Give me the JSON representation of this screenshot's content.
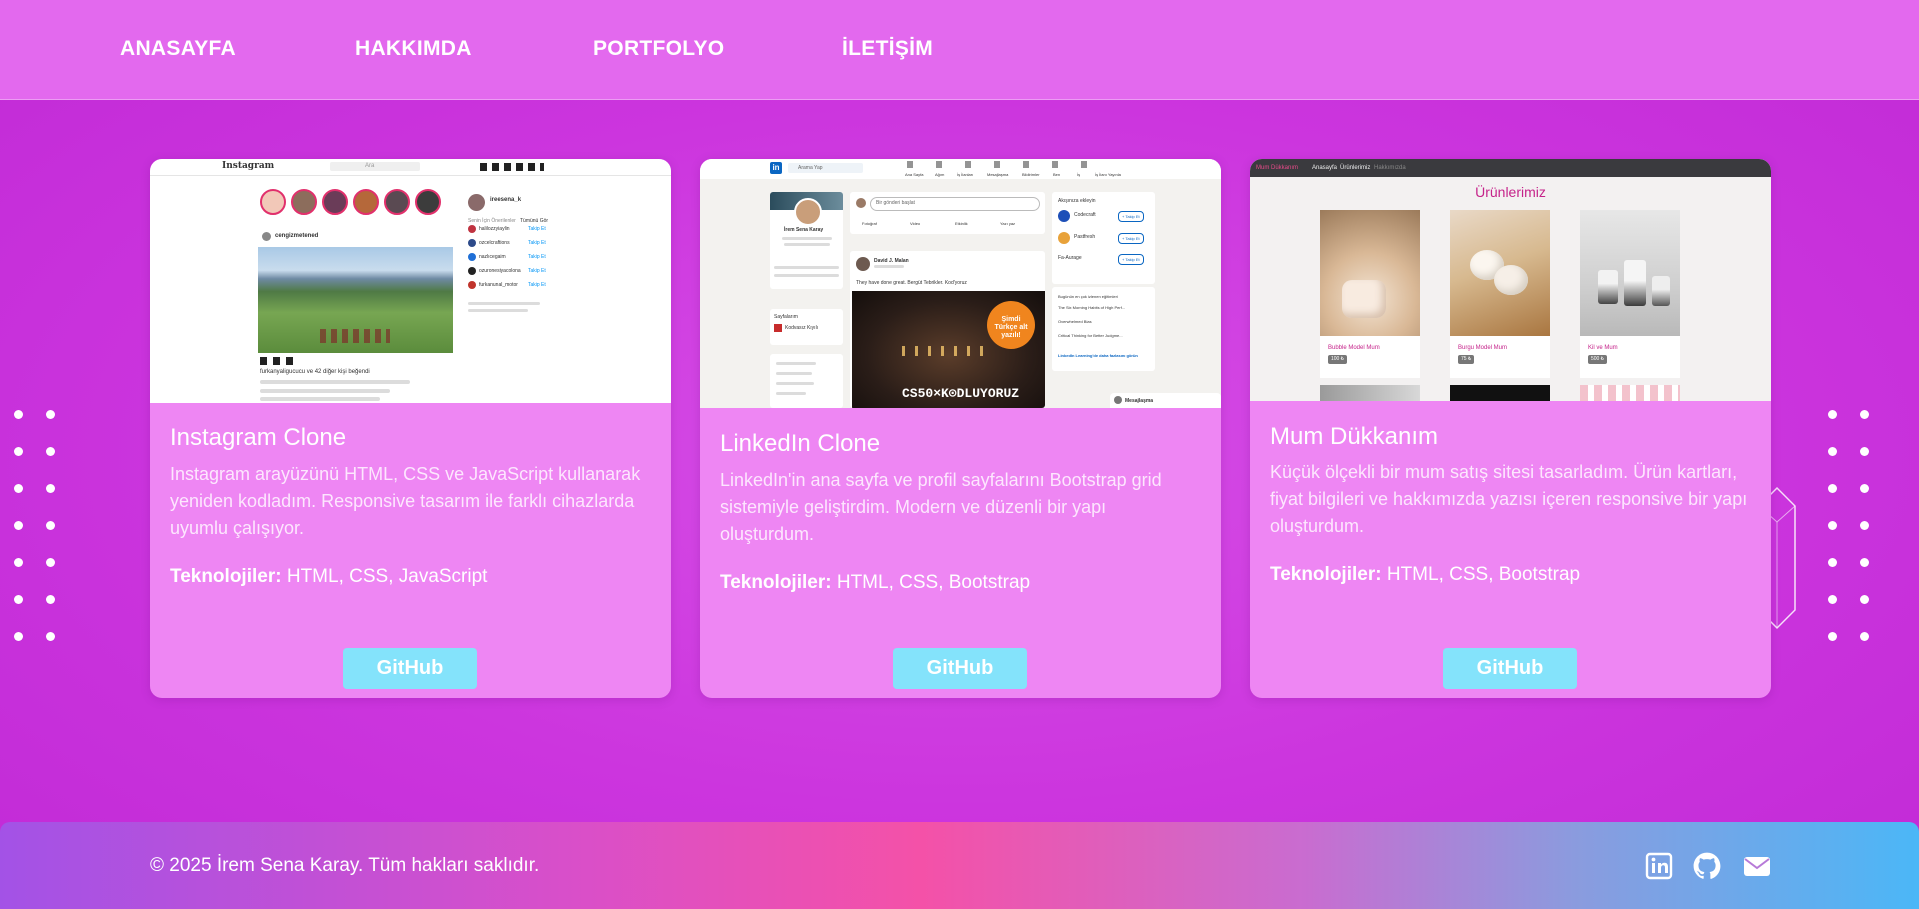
{
  "nav": {
    "items": [
      {
        "label": "ANASAYFA"
      },
      {
        "label": "HAKKIMDA"
      },
      {
        "label": "PORTFOLYO"
      },
      {
        "label": "İLETİŞİM"
      }
    ]
  },
  "projects": [
    {
      "title": "Instagram Clone",
      "description": "Instagram arayüzünü HTML, CSS ve JavaScript kullanarak yeniden kodladım. Responsive tasarım ile farklı cihazlarda uyumlu çalışıyor.",
      "tech_label": "Teknolojiler:",
      "tech": "HTML, CSS, JavaScript",
      "button": "GitHub",
      "thumb": {
        "logo": "Instagram",
        "search": "Ara",
        "username": "cengizmetened",
        "likes_line": "furkanyaligucucu ve 42 diğer kişi beğendi",
        "side_user": "ireesena_k",
        "suggest_title": "Senin İçin Önerilenler",
        "see_all": "Tümünü Gör",
        "suggestions": [
          "halilozzyiaylin",
          "ozcelcraftions",
          "nazlıcegaim",
          "ozuronesiyacolona",
          "furkanunal_motor"
        ],
        "follow": "Takip Et"
      }
    },
    {
      "title": "LinkedIn Clone",
      "description": "LinkedIn'in ana sayfa ve profil sayfalarını Bootstrap grid sistemiyle geliştirdim. Modern ve düzenli bir yapı oluşturdum.",
      "tech_label": "Teknolojiler:",
      "tech": "HTML, CSS, Bootstrap",
      "button": "GitHub",
      "thumb": {
        "search": "Arama Yap",
        "nav": [
          "Ana Sayfa",
          "Ağım",
          "İş İlanları",
          "Mesajlaşma",
          "Bildirimler",
          "Ben",
          "İş",
          "İş İlanı Yayınla"
        ],
        "profile_name": "İrem Sena Karay",
        "post_prompt": "Bir gönderi başlat",
        "post_actions": [
          "Fotoğraf",
          "Video",
          "Etkinlik",
          "Yazı yaz"
        ],
        "post_author": "David J. Malan",
        "post_text": "They have done great. Bergüt Tebrikler. Kod'yoruz",
        "banner_badge": "Şimdi Türkçe alt yazılı!",
        "banner_text": "CS50×K⊙DLUYORUZ",
        "pages_label": "Sayfalarım",
        "page_name": "Kodvasız Kıyılı",
        "add_title": "Akışınıza ekleyin",
        "add_items": [
          "Codecraft",
          "Pastfresh",
          "Fa-Aurage"
        ],
        "follow_btn": "+ Takip Et",
        "learn_title": "Bugünün en çok izlenen eğitimleri",
        "learn_items": [
          "The Six Morning Habits of High Perf...",
          "Overwhelmed Bias",
          "Critical Thinking for Better Judgme..."
        ],
        "learn_link": "LinkedIn Learning'de daha fazlasını görün",
        "messaging": "Mesajlaşma"
      }
    },
    {
      "title": "Mum Dükkanım",
      "description": "Küçük ölçekli bir mum satış sitesi tasarladım. Ürün kartları, fiyat bilgileri ve hakkımızda yazısı içeren responsive bir yapı oluşturdum.",
      "tech_label": "Teknolojiler:",
      "tech": "HTML, CSS, Bootstrap",
      "button": "GitHub",
      "thumb": {
        "brand": "Mum Dükkanım",
        "nav": [
          "Anasayfa",
          "Ürünlerimiz",
          "Hakkımızda"
        ],
        "heading": "Ürünlerimiz",
        "products": [
          {
            "name": "Bubble Model Mum",
            "price": "100 ₺"
          },
          {
            "name": "Burgu Model Mum",
            "price": "75 ₺"
          },
          {
            "name": "Kil ve Mum",
            "price": "500 ₺"
          }
        ]
      }
    }
  ],
  "footer": {
    "copyright": "© 2025 İrem Sena Karay. Tüm hakları saklıdır."
  },
  "colors": {
    "page_bg": "#cc35de",
    "nav_bg": "#e369ee",
    "card_bg": "#ee86f3",
    "button_bg": "#84e3fb"
  },
  "icons": [
    "linkedin-icon",
    "github-icon",
    "mail-icon"
  ]
}
